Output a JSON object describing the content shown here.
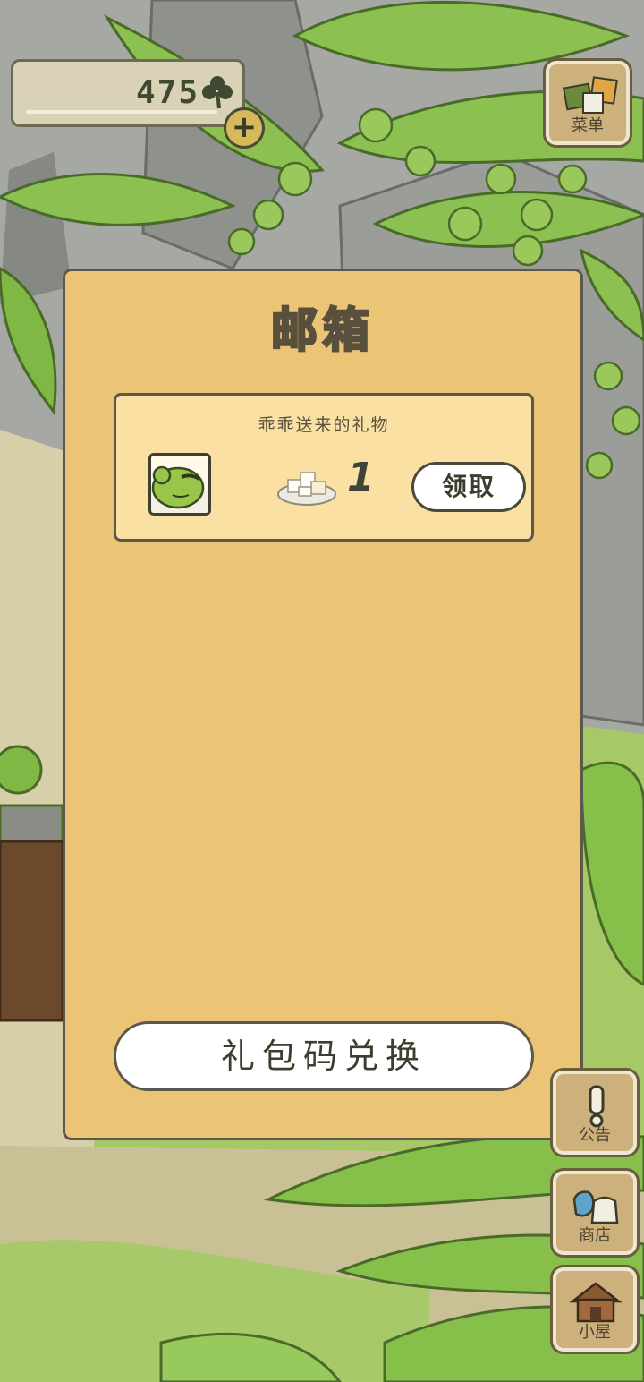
{
  "top_bar": {
    "clover_count": "475",
    "clover_icon": "clover-icon",
    "add_icon": "plus-icon"
  },
  "menu_button": {
    "label": "菜单",
    "icon": "menu-cards-icon"
  },
  "mailbox": {
    "title": "邮箱",
    "items": [
      {
        "sender": "乖乖送来的礼物",
        "avatar_icon": "frog-avatar-icon",
        "gift_icon": "tofu-plate-icon",
        "quantity": "1",
        "claim_label": "领取"
      }
    ],
    "redeem_label": "礼包码兑换"
  },
  "side_buttons": [
    {
      "label": "公告",
      "icon": "exclamation-icon"
    },
    {
      "label": "商店",
      "icon": "shop-bags-icon"
    },
    {
      "label": "小屋",
      "icon": "house-icon"
    }
  ],
  "colors": {
    "panel": "#ecc475",
    "item_bg": "#fbe0a3",
    "outline": "#5b5a4a",
    "title_fill": "#fff7e8"
  }
}
